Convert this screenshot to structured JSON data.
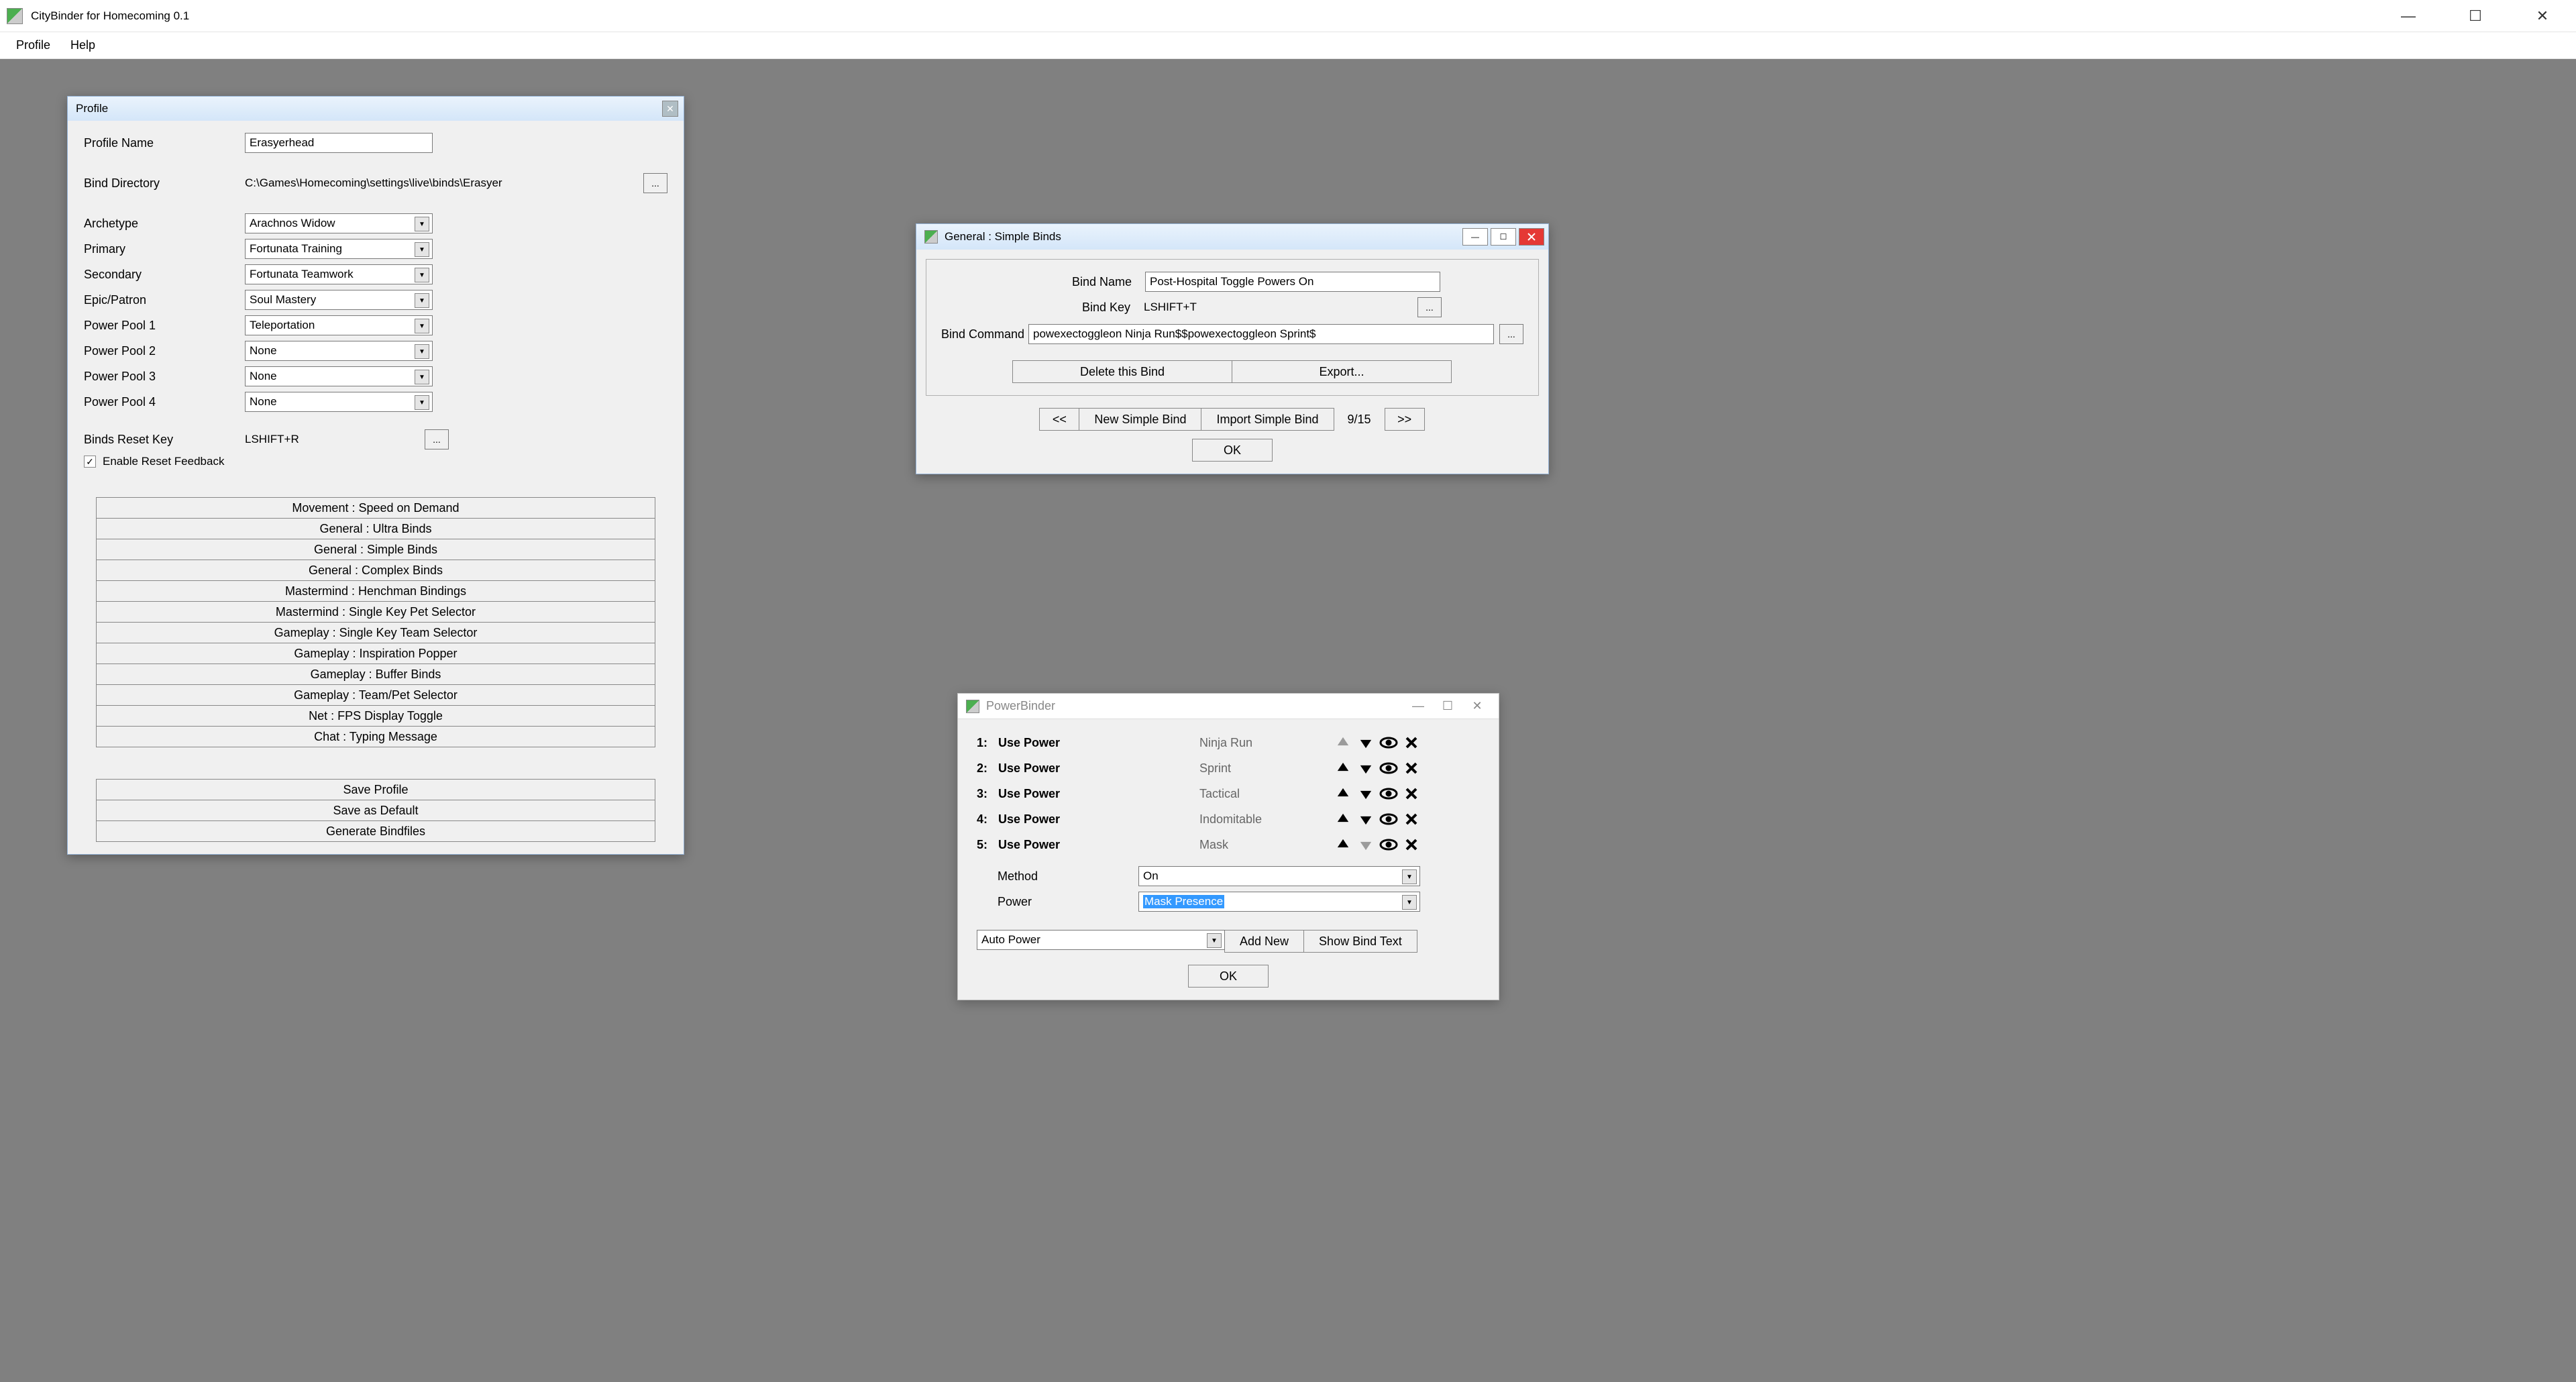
{
  "app": {
    "title": "CityBinder for Homecoming 0.1",
    "menus": [
      "Profile",
      "Help"
    ]
  },
  "profile": {
    "window_title": "Profile",
    "name_label": "Profile Name",
    "name_value": "Erasyerhead",
    "binddir_label": "Bind Directory",
    "binddir_value": "C:\\Games\\Homecoming\\settings\\live\\binds\\Erasyer",
    "fields": [
      {
        "label": "Archetype",
        "value": "Arachnos Widow"
      },
      {
        "label": "Primary",
        "value": "Fortunata Training"
      },
      {
        "label": "Secondary",
        "value": "Fortunata Teamwork"
      },
      {
        "label": "Epic/Patron",
        "value": "Soul Mastery"
      },
      {
        "label": "Power Pool 1",
        "value": "Teleportation"
      },
      {
        "label": "Power Pool 2",
        "value": "None"
      },
      {
        "label": "Power Pool 3",
        "value": "None"
      },
      {
        "label": "Power Pool 4",
        "value": "None"
      }
    ],
    "reset_label": "Binds Reset Key",
    "reset_value": "LSHIFT+R",
    "reset_feedback_label": "Enable Reset Feedback",
    "reset_feedback_checked": true,
    "modules": [
      "Movement : Speed on Demand",
      "General : Ultra Binds",
      "General : Simple Binds",
      "General : Complex Binds",
      "Mastermind : Henchman Bindings",
      "Mastermind : Single Key Pet Selector",
      "Gameplay : Single Key Team Selector",
      "Gameplay : Inspiration Popper",
      "Gameplay : Buffer Binds",
      "Gameplay : Team/Pet Selector",
      "Net : FPS Display Toggle",
      "Chat : Typing Message"
    ],
    "actions": [
      "Save Profile",
      "Save as Default",
      "Generate Bindfiles"
    ]
  },
  "simple_binds": {
    "window_title": "General : Simple Binds",
    "name_label": "Bind Name",
    "name_value": "Post-Hospital Toggle Powers On",
    "key_label": "Bind Key",
    "key_value": "LSHIFT+T",
    "cmd_label": "Bind Command",
    "cmd_value": "powexectoggleon Ninja Run$$powexectoggleon Sprint$",
    "delete_btn": "Delete this Bind",
    "export_btn": "Export...",
    "prev": "<<",
    "new_btn": "New Simple Bind",
    "import_btn": "Import Simple Bind",
    "counter": "9/15",
    "next": ">>",
    "ok": "OK"
  },
  "powerbinder": {
    "window_title": "PowerBinder",
    "rows": [
      {
        "n": "1:",
        "label": "Use Power",
        "power": "Ninja Run",
        "up_disabled": true,
        "down_disabled": false
      },
      {
        "n": "2:",
        "label": "Use Power",
        "power": "Sprint",
        "up_disabled": false,
        "down_disabled": false
      },
      {
        "n": "3:",
        "label": "Use Power",
        "power": "Tactical",
        "up_disabled": false,
        "down_disabled": false
      },
      {
        "n": "4:",
        "label": "Use Power",
        "power": "Indomitable",
        "up_disabled": false,
        "down_disabled": false
      },
      {
        "n": "5:",
        "label": "Use Power",
        "power": "Mask",
        "up_disabled": false,
        "down_disabled": true
      }
    ],
    "method_label": "Method",
    "method_value": "On",
    "power_label": "Power",
    "power_value": "Mask Presence",
    "addtype": "Auto Power",
    "add_btn": "Add New",
    "show_btn": "Show Bind Text",
    "ok": "OK"
  }
}
